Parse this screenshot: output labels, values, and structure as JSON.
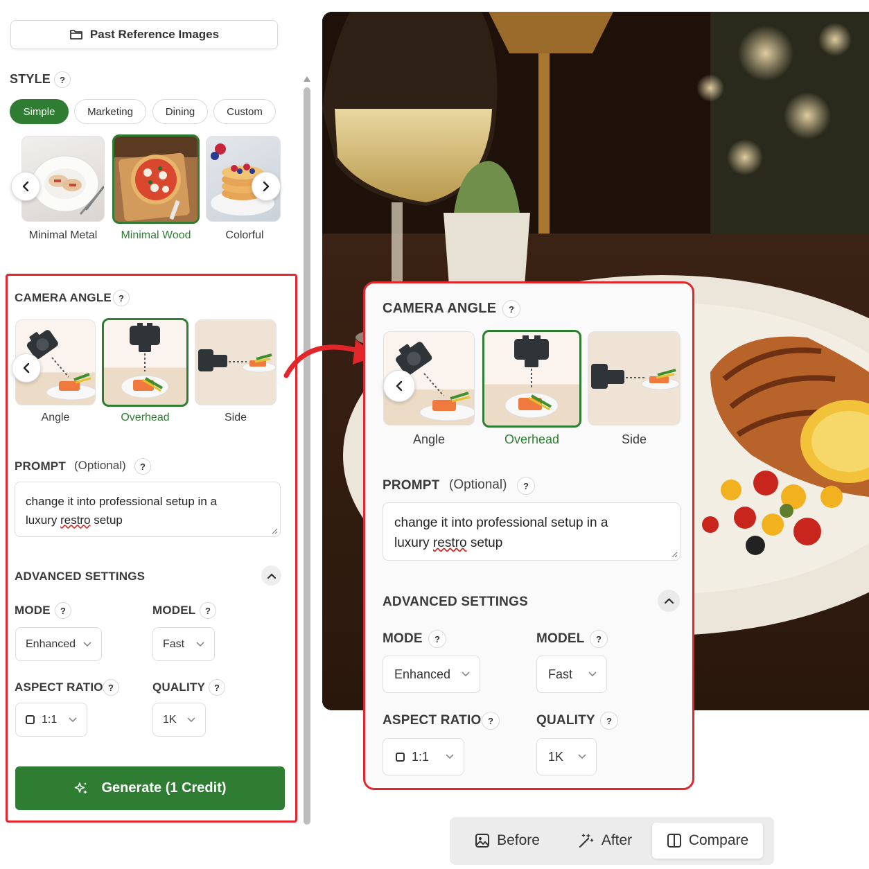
{
  "header": {
    "past_refs_label": "Past Reference Images"
  },
  "style": {
    "title": "STYLE",
    "help": "?",
    "chips": [
      "Simple",
      "Marketing",
      "Dining",
      "Custom"
    ],
    "active_chip": "Simple",
    "thumbs": [
      {
        "label": "Minimal Metal",
        "selected": false
      },
      {
        "label": "Minimal Wood",
        "selected": true
      },
      {
        "label": "Colorful",
        "selected": false
      }
    ]
  },
  "camera": {
    "title": "CAMERA ANGLE",
    "help": "?",
    "options": [
      {
        "label": "Angle",
        "selected": false
      },
      {
        "label": "Overhead",
        "selected": true
      },
      {
        "label": "Side",
        "selected": false
      }
    ]
  },
  "prompt": {
    "title": "PROMPT",
    "optional": "(Optional)",
    "help": "?",
    "line1": "change it into professional setup in a",
    "line2_a": "luxury ",
    "line2_b": "restro",
    "line2_c": " setup"
  },
  "advanced": {
    "title": "ADVANCED SETTINGS",
    "mode_label": "MODE",
    "mode_value": "Enhanced",
    "model_label": "MODEL",
    "model_value": "Fast",
    "aspect_label": "ASPECT RATIO",
    "aspect_value": "1:1",
    "quality_label": "QUALITY",
    "quality_value": "1K",
    "help": "?"
  },
  "generate_label": "Generate (1 Credit)",
  "view_toggle": {
    "before": "Before",
    "after": "After",
    "compare": "Compare",
    "active": "Compare"
  },
  "colors": {
    "accent_green": "#2e7d32",
    "highlight_red": "#e3262c"
  }
}
